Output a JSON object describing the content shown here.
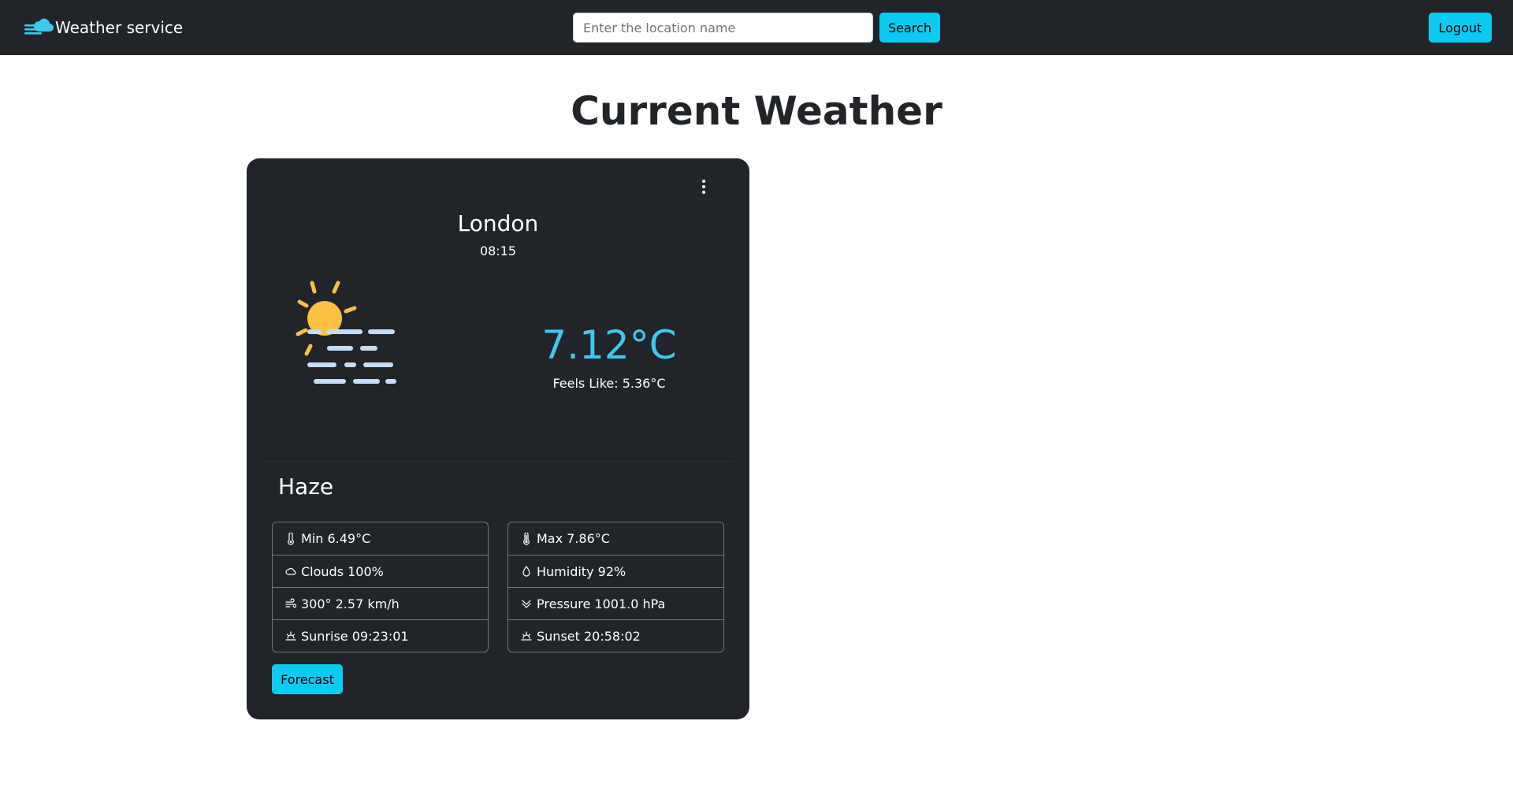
{
  "navbar": {
    "brand": "Weather service",
    "brand_icon": "cloud-icon",
    "search_placeholder": "Enter the location name",
    "search_value": "",
    "search_label": "Search",
    "logout_label": "Logout"
  },
  "page_title": "Current Weather",
  "card": {
    "city": "London",
    "time": "08:15",
    "icon": "haze-sun-icon",
    "temperature": "7.12°C",
    "feels_like": "Feels Like: 5.36°C",
    "description": "Haze",
    "left_details": [
      {
        "icon": "thermometer-low-icon",
        "label": "Min 6.49°C"
      },
      {
        "icon": "cloud-icon",
        "label": "Clouds 100%"
      },
      {
        "icon": "wind-icon",
        "label": "300° 2.57 km/h"
      },
      {
        "icon": "sunrise-icon",
        "label": "Sunrise 09:23:01"
      }
    ],
    "right_details": [
      {
        "icon": "thermometer-high-icon",
        "label": "Max 7.86°C"
      },
      {
        "icon": "droplet-icon",
        "label": "Humidity 92%"
      },
      {
        "icon": "chevron-double-down-icon",
        "label": "Pressure 1001.0 hPa"
      },
      {
        "icon": "sunset-icon",
        "label": "Sunset 20:58:02"
      }
    ],
    "forecast_label": "Forecast"
  },
  "colors": {
    "navbar_bg": "#212529",
    "card_bg": "#212529",
    "accent": "#0dcaf0",
    "temperature": "#3dc8ef",
    "sun": "#fbbf41",
    "haze": "#c5ddf6"
  }
}
